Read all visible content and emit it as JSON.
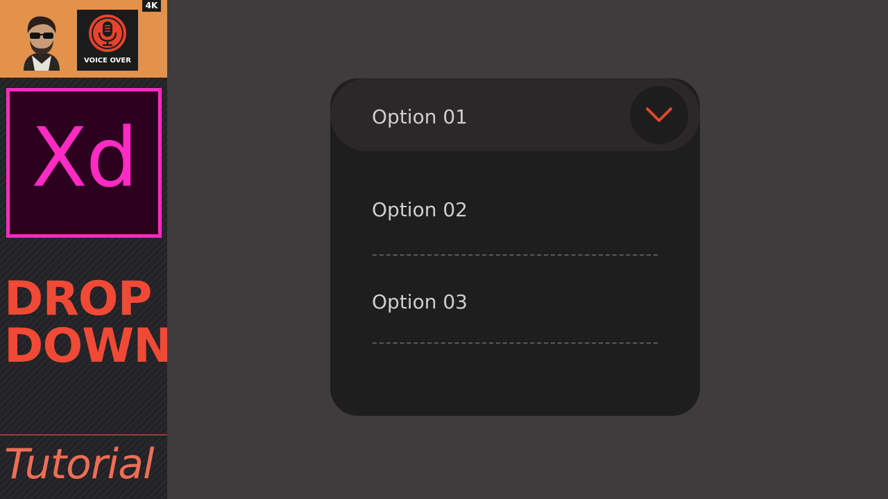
{
  "sidebar": {
    "badge": "4K",
    "voice_label": "VOICE OVER",
    "logo_text": "Xd",
    "title_line1": "DROP",
    "title_line2": "DOWN",
    "subtitle": "Tutorial"
  },
  "dropdown": {
    "selected": "Option 01",
    "options": [
      "Option 02",
      "Option 03"
    ],
    "toggle_icon": "chevron-down-icon"
  },
  "colors": {
    "canvas_bg": "#3e3c3d",
    "card_bg": "#1e1e1e",
    "header_bg": "#2c2728",
    "chevron": "#e0472c",
    "xd_magenta": "#ff2bc2",
    "xd_dark": "#2e001f",
    "title_red": "#f04a36",
    "banner_orange": "#e2924a"
  }
}
